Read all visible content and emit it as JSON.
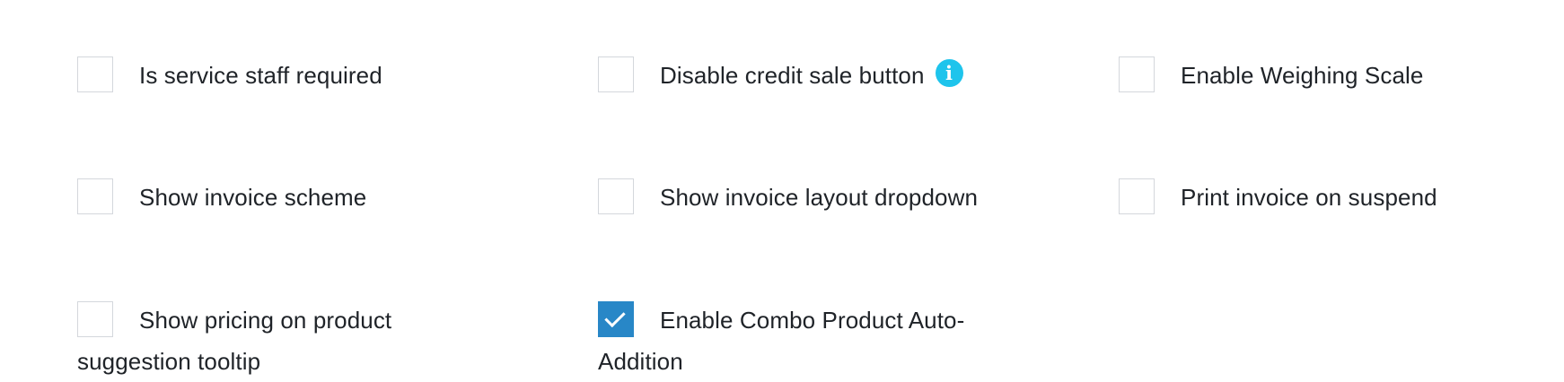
{
  "options": [
    {
      "label": "Is service staff required",
      "checked": false
    },
    {
      "label": "Disable credit sale button",
      "checked": false,
      "has_info_icon": true,
      "info_icon": "info-circle-icon"
    },
    {
      "label": "Enable Weighing Scale",
      "checked": false
    },
    {
      "label": "Show invoice scheme",
      "checked": false
    },
    {
      "label": "Show invoice layout dropdown",
      "checked": false
    },
    {
      "label": "Print invoice on suspend",
      "checked": false
    },
    {
      "label": "Show pricing on product suggestion tooltip",
      "checked": false
    },
    {
      "label": "Enable Combo Product Auto-Addition",
      "checked": true
    }
  ],
  "colors": {
    "checkbox_checked": "#2887c7",
    "checkbox_border": "#d4d7dc",
    "info_icon": "#1ec4ec",
    "text": "#1f2328"
  }
}
